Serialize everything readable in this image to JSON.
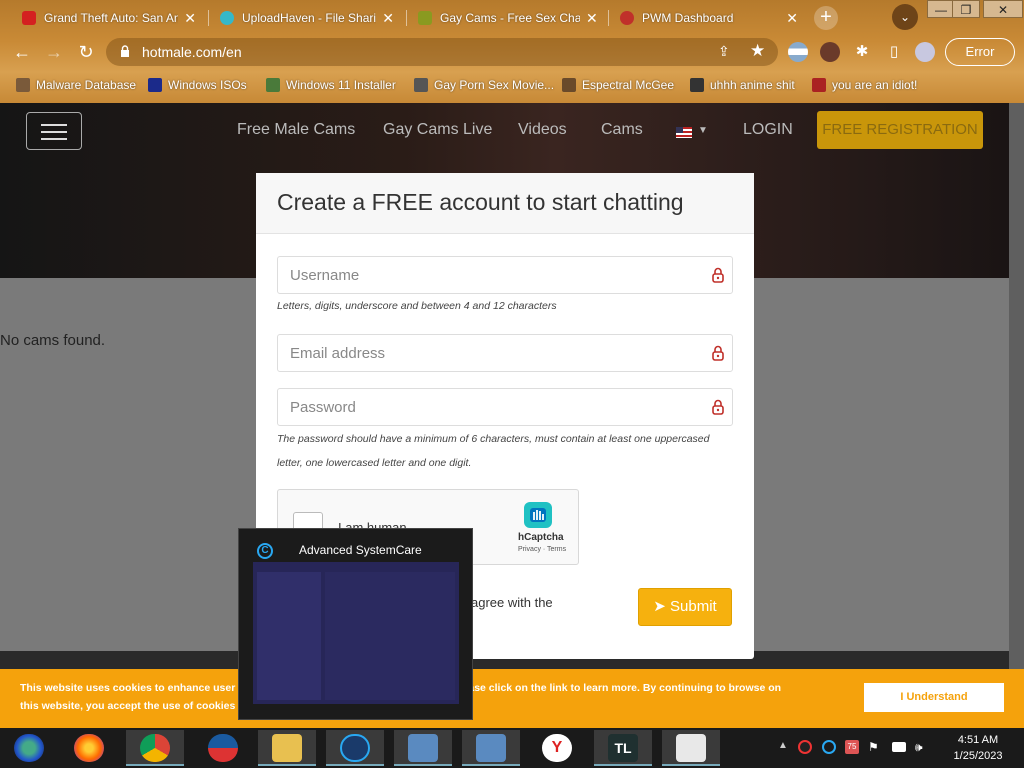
{
  "tabs": [
    {
      "title": "Grand Theft Auto: San Andreas",
      "favicon_color": "#d42020"
    },
    {
      "title": "UploadHaven - File Sharing",
      "favicon_color": "#35b8c9"
    },
    {
      "title": "Gay Cams - Free Sex Chat",
      "favicon_color": "#8a9a20"
    },
    {
      "title": "PWM Dashboard",
      "favicon_color": "#c0302a"
    }
  ],
  "window_controls": {
    "minimize": "—",
    "restore": "❐",
    "close": "✕"
  },
  "address_bar": {
    "url": "hotmale.com/en"
  },
  "error_button": "Error",
  "bookmarks": [
    {
      "label": "Malware Database",
      "color": "#7a5a3a"
    },
    {
      "label": "Windows ISOs",
      "color": "#1b2a8a"
    },
    {
      "label": "Windows 11 Installer",
      "color": "#4a7a3a"
    },
    {
      "label": "Gay Porn Sex Movie...",
      "color": "#555"
    },
    {
      "label": "Espectral McGee",
      "color": "#6a4a2a"
    },
    {
      "label": "uhhh anime shit",
      "color": "#333"
    },
    {
      "label": "you are an idiot!",
      "color": "#aa2222"
    }
  ],
  "site_nav": {
    "links": [
      "Free Male Cams",
      "Gay Cams Live",
      "Videos",
      "Cams"
    ],
    "login": "LOGIN",
    "register": "FREE REGISTRATION"
  },
  "no_cams": "No cams found.",
  "modal": {
    "title": "Create a FREE account to start chatting",
    "username_placeholder": "Username",
    "username_hint": "Letters, digits, underscore and between 4 and 12 characters",
    "email_placeholder": "Email address",
    "password_placeholder": "Password",
    "password_hint": "The password should have a minimum of 6 characters, must contain at least one uppercased letter, one lowercased letter and one digit.",
    "captcha_label": "I am human",
    "captcha_brand": "hCaptcha",
    "captcha_links": "Privacy · Terms",
    "agree_text": "agree with the",
    "submit": "Submit"
  },
  "cookie": {
    "text_left": "This website uses cookies to enhance user n",
    "text_right": "information please click on the link to learn more. By continuing to browse on",
    "text_line2": "this website, you accept the use of cookies fo",
    "button": "I Understand"
  },
  "thumbnail": {
    "title": "Advanced SystemCare"
  },
  "clock": {
    "time": "4:51 AM",
    "date": "1/25/2023"
  },
  "tray_badge": "75",
  "colors": {
    "accent": "#f6b10e",
    "cookie_bar": "#f5a20c",
    "lock_red": "#c0302a"
  }
}
